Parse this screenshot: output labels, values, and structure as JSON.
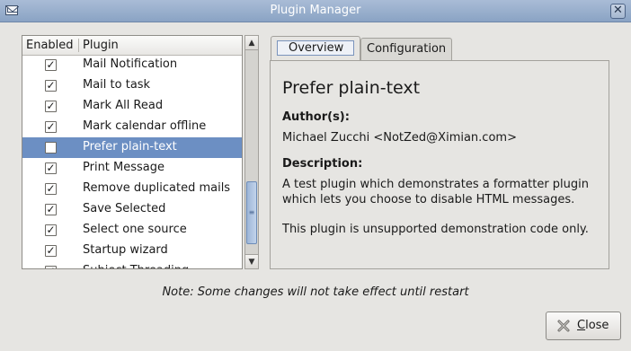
{
  "window": {
    "title": "Plugin Manager",
    "close_glyph": "✕"
  },
  "list": {
    "headers": {
      "enabled": "Enabled",
      "plugin": "Plugin"
    },
    "rows": [
      {
        "name": "Mail Notification",
        "enabled": true,
        "selected": false
      },
      {
        "name": "Mail to task",
        "enabled": true,
        "selected": false
      },
      {
        "name": "Mark All Read",
        "enabled": true,
        "selected": false
      },
      {
        "name": "Mark calendar offline",
        "enabled": true,
        "selected": false
      },
      {
        "name": "Prefer plain-text",
        "enabled": false,
        "selected": true
      },
      {
        "name": "Print Message",
        "enabled": true,
        "selected": false
      },
      {
        "name": "Remove duplicated mails",
        "enabled": true,
        "selected": false
      },
      {
        "name": "Save Selected",
        "enabled": true,
        "selected": false
      },
      {
        "name": "Select one source",
        "enabled": true,
        "selected": false
      },
      {
        "name": "Startup wizard",
        "enabled": true,
        "selected": false
      },
      {
        "name": "Subject Threading",
        "enabled": true,
        "selected": false
      }
    ],
    "check_glyph": "✓"
  },
  "tabs": {
    "overview": "Overview",
    "configuration": "Configuration"
  },
  "details": {
    "title": "Prefer plain-text",
    "authors_label": "Author(s):",
    "authors_value": "Michael Zucchi <NotZed@Ximian.com>",
    "description_label": "Description:",
    "description": "A test plugin which demonstrates a formatter plugin which lets you choose to disable HTML messages.",
    "note": "This plugin is unsupported demonstration code only."
  },
  "footer_note": "Note: Some changes will not take effect until restart",
  "close_button": {
    "mnemonic": "C",
    "rest": "lose"
  }
}
